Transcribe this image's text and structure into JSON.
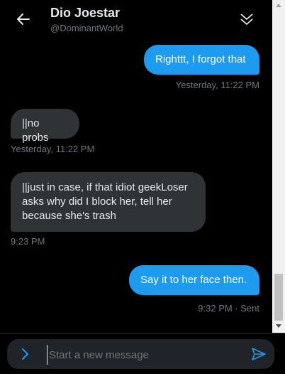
{
  "header": {
    "title": "Dio Joestar",
    "handle": "@DominantWorld",
    "back_icon": "arrow-left-icon",
    "collapse_icon": "double-chevron-down-icon"
  },
  "messages": [
    {
      "direction": "outgoing",
      "text": "Righttt, I forgot that",
      "timestamp": "Yesterday, 11:22 PM"
    },
    {
      "direction": "incoming",
      "text": "||no probs",
      "timestamp": "Yesterday, 11:22 PM"
    },
    {
      "direction": "incoming",
      "text_lines": [
        "||just in case, if that idiot geekLoser",
        "asks why did I block her, tell her",
        "because she's trash"
      ],
      "timestamp": "9:23 PM"
    },
    {
      "direction": "outgoing",
      "text": "Say it to her face then.",
      "timestamp": "9:32 PM · Sent"
    }
  ],
  "composer": {
    "placeholder": "Start a new message",
    "value": "",
    "media_icon": "chevron-right-icon",
    "send_icon": "send-icon"
  },
  "colors": {
    "background": "#000000",
    "outgoing_bubble": "#1d9bf0",
    "incoming_bubble": "#2f3336",
    "muted_text": "#71767b",
    "accent": "#1d9bf0"
  }
}
